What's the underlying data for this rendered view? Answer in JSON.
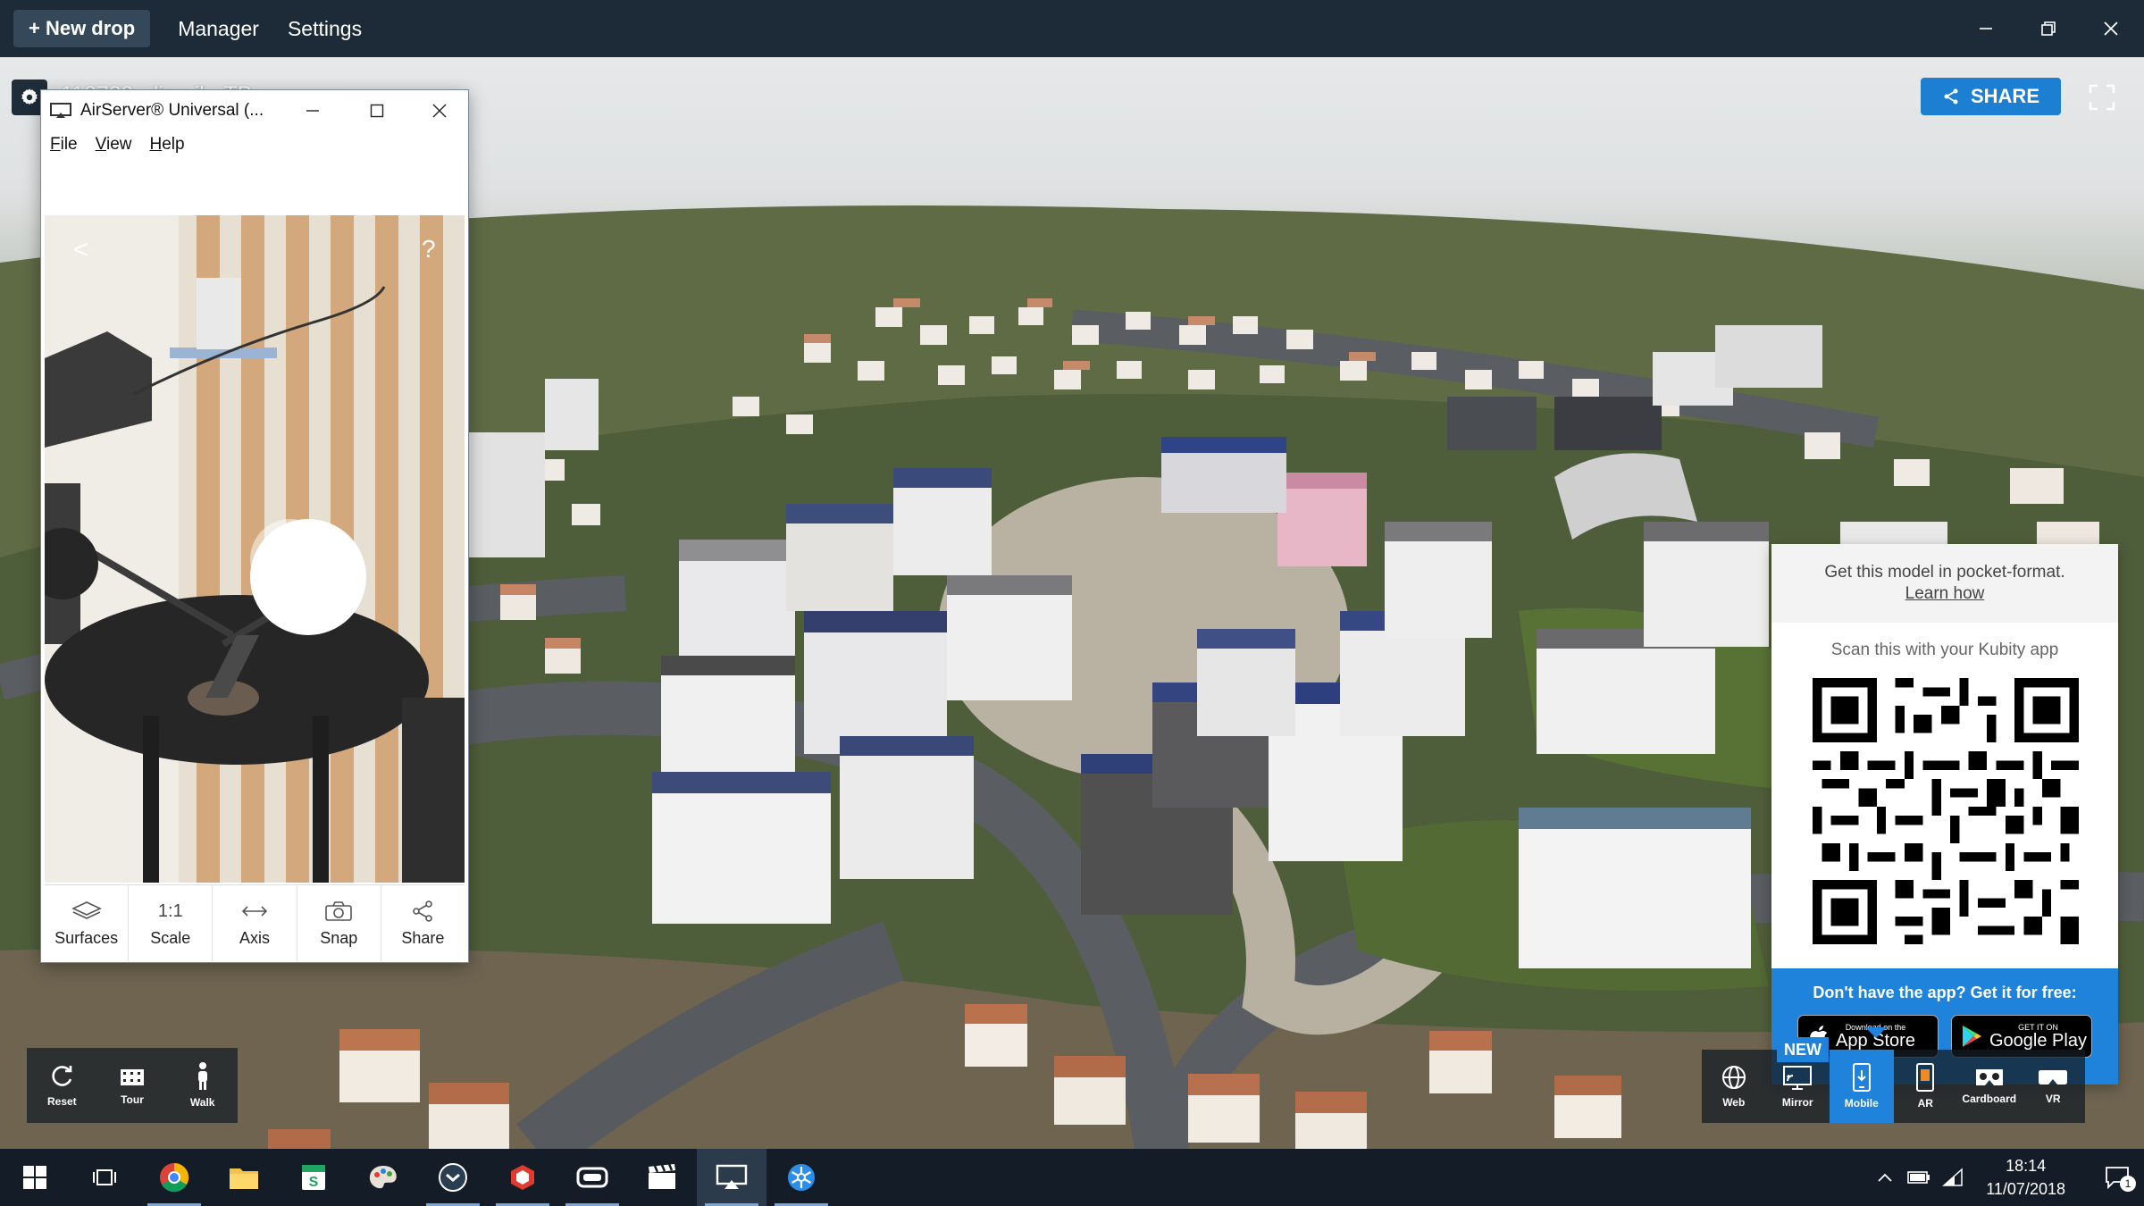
{
  "topbar": {
    "new_drop": "+ New drop",
    "manager": "Manager",
    "settings": "Settings"
  },
  "viewer": {
    "title": "110729 - limeil - TB",
    "share": "SHARE"
  },
  "airserver": {
    "title": "AirServer® Universal (...",
    "menu": [
      "File",
      "View",
      "Help"
    ],
    "back": "<",
    "help": "?",
    "toolbar": [
      {
        "label": "Surfaces",
        "icon": "surfaces-icon"
      },
      {
        "label": "Scale",
        "icon": "1:1"
      },
      {
        "label": "Axis",
        "icon": "axis-icon"
      },
      {
        "label": "Snap",
        "icon": "camera-icon"
      },
      {
        "label": "Share",
        "icon": "share-icon"
      }
    ]
  },
  "kubity_popup": {
    "headline": "Get this model in pocket-format.",
    "learn_more": "Learn how",
    "scan": "Scan this with your Kubity app",
    "footer": "Don't have the app? Get it for free:",
    "app_store_small": "Download on the",
    "app_store": "App Store",
    "google_play_small": "GET IT ON",
    "google_play": "Google Play"
  },
  "left_toolbar": [
    {
      "label": "Reset",
      "icon": "reset-icon"
    },
    {
      "label": "Tour",
      "icon": "tour-icon"
    },
    {
      "label": "Walk",
      "icon": "walk-icon"
    }
  ],
  "right_toolbar": {
    "badge": "NEW",
    "items": [
      {
        "label": "Web",
        "icon": "web-icon"
      },
      {
        "label": "Mirror",
        "icon": "mirror-icon"
      },
      {
        "label": "Mobile",
        "icon": "mobile-icon",
        "active": true
      },
      {
        "label": "AR",
        "icon": "ar-icon"
      },
      {
        "label": "Cardboard",
        "icon": "cardboard-icon"
      },
      {
        "label": "VR",
        "icon": "vr-icon"
      }
    ]
  },
  "taskbar": {
    "time": "18:14",
    "date": "11/07/2018",
    "notifications": "1"
  },
  "colors": {
    "topbar": "#1d2b38",
    "accent": "#1f82db",
    "share_button": "#1d7fd1",
    "taskbar": "#141d27"
  }
}
